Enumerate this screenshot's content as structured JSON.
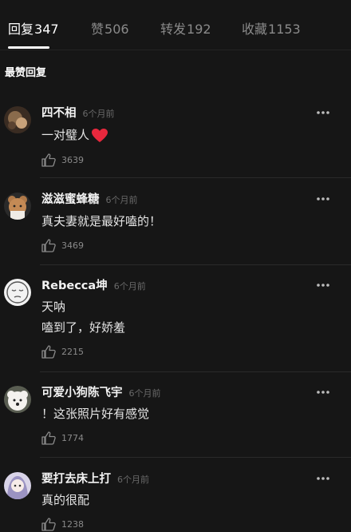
{
  "tabs": [
    {
      "label": "回复",
      "count": "347"
    },
    {
      "label": "赞",
      "count": "506"
    },
    {
      "label": "转发",
      "count": "192"
    },
    {
      "label": "收藏",
      "count": "1153"
    }
  ],
  "section_title": "最赞回复",
  "comments": [
    {
      "user": "四不相",
      "time": "6个月前",
      "lines": [
        "一对璧人"
      ],
      "likes": "3639",
      "emoji": "heart-emoji-icon"
    },
    {
      "user": "滋滋蜜蜂糖",
      "time": "6个月前",
      "lines": [
        "真夫妻就是最好嗑的！"
      ],
      "likes": "3469"
    },
    {
      "user": "Rebecca坤",
      "time": "6个月前",
      "lines": [
        "天呐",
        "嗑到了，好娇羞"
      ],
      "likes": "2215"
    },
    {
      "user": "可爱小狗陈飞宇",
      "time": "6个月前",
      "lines": [
        "！这张照片好有感觉"
      ],
      "likes": "1774"
    },
    {
      "user": "要打去床上打",
      "time": "6个月前",
      "lines": [
        "真的很配"
      ],
      "likes": "1238"
    }
  ],
  "colors": {
    "background": "#161616",
    "heart": "#e8283d",
    "muted": "#8a8a8a"
  }
}
